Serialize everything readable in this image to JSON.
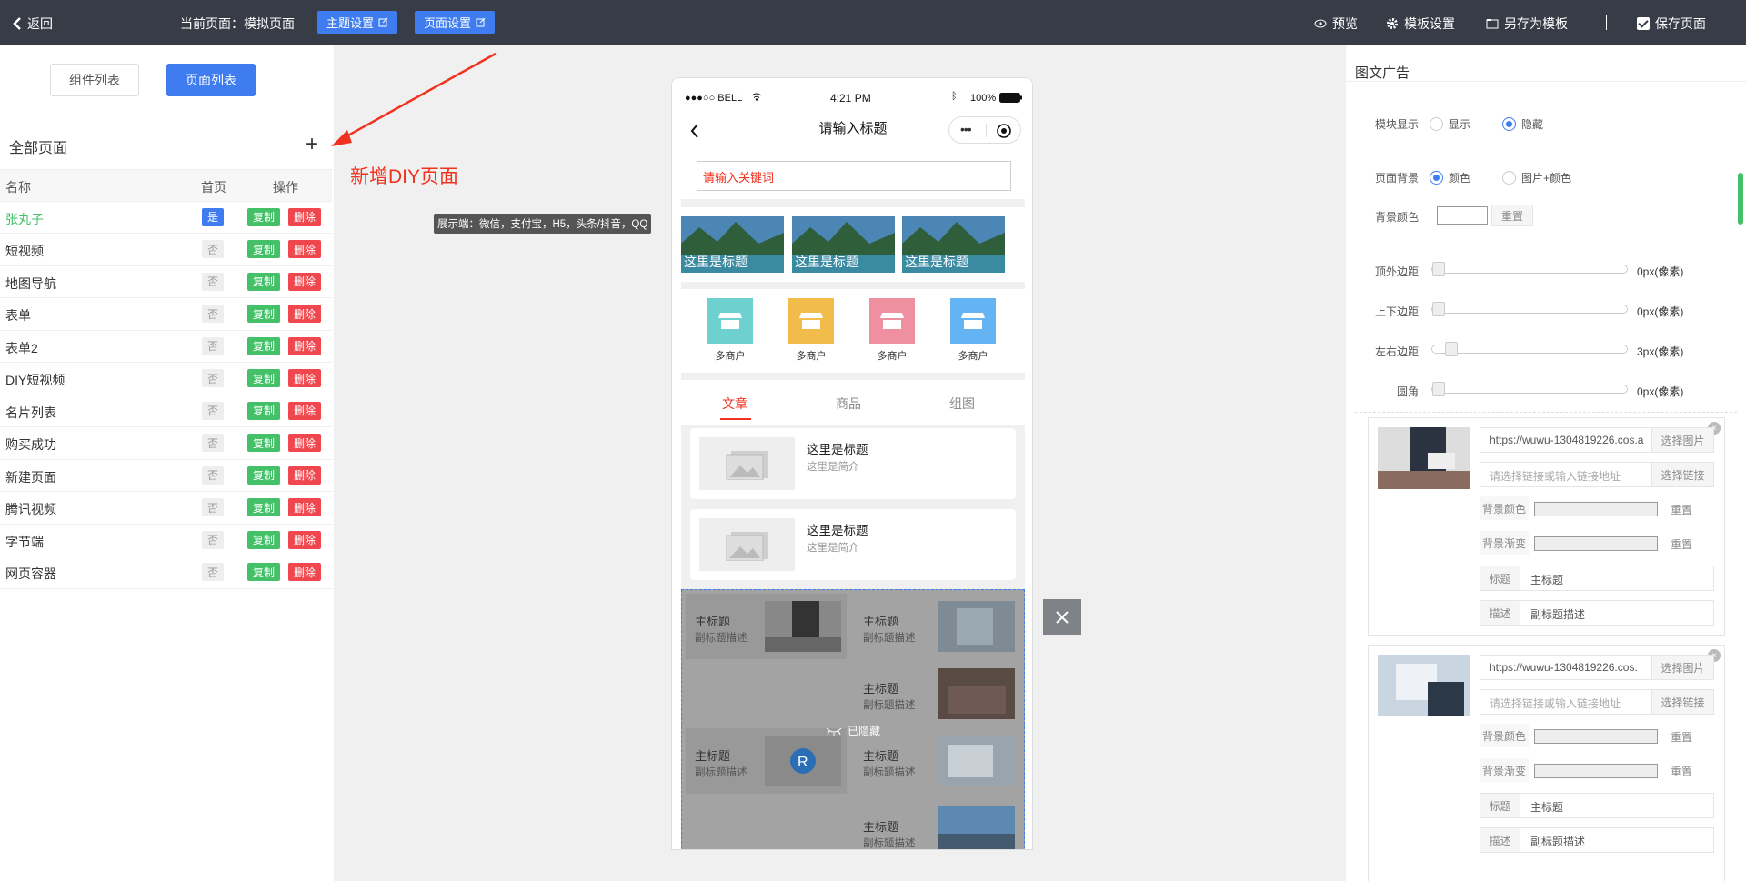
{
  "topbar": {
    "back_label": "返回",
    "current_page_label": "当前页面：模拟页面",
    "theme_btn": "主题设置",
    "page_btn": "页面设置",
    "preview": "预览",
    "template_settings": "模板设置",
    "save_as_template": "另存为模板",
    "save_page": "保存页面"
  },
  "left": {
    "tab_components": "组件列表",
    "tab_pages": "页面列表",
    "all_pages": "全部页面",
    "add_icon": "+",
    "headers": {
      "name": "名称",
      "home": "首页",
      "ops": "操作"
    },
    "copy": "复制",
    "delete": "删除",
    "pages": [
      {
        "name": "张丸子",
        "home": "是"
      },
      {
        "name": "短视频",
        "home": "否"
      },
      {
        "name": "地图导航",
        "home": "否"
      },
      {
        "name": "表单",
        "home": "否"
      },
      {
        "name": "表单2",
        "home": "否"
      },
      {
        "name": "DIY短视频",
        "home": "否"
      },
      {
        "name": "名片列表",
        "home": "否"
      },
      {
        "name": "购买成功",
        "home": "否"
      },
      {
        "name": "新建页面",
        "home": "否"
      },
      {
        "name": "腾讯视频",
        "home": "否"
      },
      {
        "name": "字节端",
        "home": "否"
      },
      {
        "name": "网页容器",
        "home": "否"
      }
    ]
  },
  "center": {
    "note": "新增DIY页面",
    "tooltip": "展示端：微信，支付宝，H5，头条/抖音，QQ"
  },
  "phone": {
    "carrier": "●●●○○ BELL",
    "time": "4:21 PM",
    "battery": "100%",
    "title": "请输入标题",
    "search_placeholder": "请输入关键词",
    "banner_caption": "这里是标题",
    "merchant_label": "多商户",
    "tabs": [
      "文章",
      "商品",
      "组图"
    ],
    "article_title": "这里是标题",
    "article_sub": "这里是简介",
    "cell_title": "主标题",
    "cell_sub": "副标题描述",
    "hidden_label": "已隐藏"
  },
  "right": {
    "title": "图文广告",
    "module_display": "模块显示",
    "show": "显示",
    "hide": "隐藏",
    "page_bg": "页面背景",
    "color": "颜色",
    "img_color": "图片+颜色",
    "bg_color": "背景颜色",
    "reset": "重置",
    "top_margin": "顶外边距",
    "tb_margin": "上下边距",
    "lr_margin": "左右边距",
    "radius": "圆角",
    "top_margin_val": "0px(像素)",
    "tb_margin_val": "0px(像素)",
    "lr_margin_val": "3px(像素)",
    "radius_val": "0px(像素)",
    "cards": [
      {
        "url": "https://wuwu-1304819226.cos.a",
        "link_ph": "请选择链接或输入链接地址",
        "title_val": "主标题",
        "desc_val": "副标题描述"
      },
      {
        "url": "https://wuwu-1304819226.cos.",
        "link_ph": "请选择链接或输入链接地址",
        "title_val": "主标题",
        "desc_val": "副标题描述"
      }
    ],
    "choose_img": "选择图片",
    "choose_link": "选择链接",
    "bg_color_lbl": "背景颜色",
    "bg_grad_lbl": "背景渐变",
    "title_lbl": "标题",
    "desc_lbl": "描述",
    "del_icon": "×"
  },
  "colors": {
    "accent": "#3e7cf0",
    "topbar": "#383c47",
    "danger": "#f0474e",
    "success": "#43c068",
    "note": "#f0321f"
  }
}
